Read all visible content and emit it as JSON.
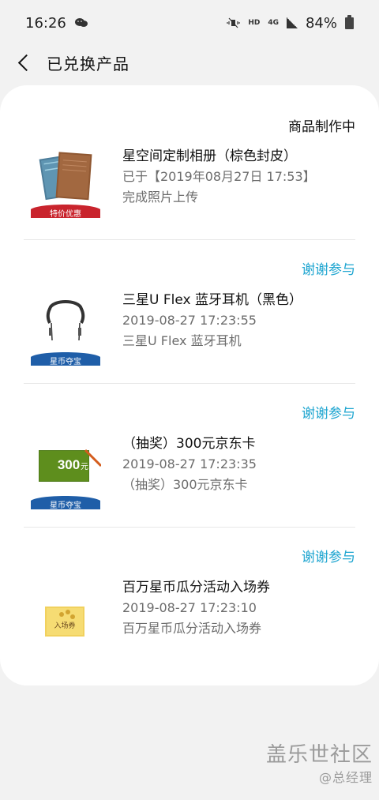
{
  "status_bar": {
    "time": "16:26",
    "battery": "84%",
    "network": "4G",
    "hd": "HD"
  },
  "header": {
    "title": "已兑换产品"
  },
  "products": [
    {
      "status": "商品制作中",
      "name": "星空间定制相册（棕色封皮）",
      "line1": "已于【2019年08月27日 17:53】",
      "line2": "完成照片上传",
      "badge": "特价优惠"
    },
    {
      "status": "谢谢参与",
      "name": "三星U Flex 蓝牙耳机（黑色）",
      "line1": "2019-08-27 17:23:55",
      "line2": "三星U Flex 蓝牙耳机",
      "badge": "星币夺宝"
    },
    {
      "status": "谢谢参与",
      "name": "（抽奖）300元京东卡",
      "line1": "2019-08-27 17:23:35",
      "line2": "（抽奖）300元京东卡",
      "badge": "星币夺宝",
      "card_value": "300",
      "card_unit": "元"
    },
    {
      "status": "谢谢参与",
      "name": "百万星币瓜分活动入场券",
      "line1": "2019-08-27 17:23:10",
      "line2": "百万星币瓜分活动入场券",
      "ticket_label": "入场券"
    }
  ],
  "watermark": {
    "title": "盖乐世社区",
    "subtitle": "@总经理"
  },
  "colors": {
    "accent": "#1ea5d0",
    "badge_red": "#c9242d",
    "badge_blue": "#1f5ea8",
    "card_green": "#4f7c19"
  }
}
